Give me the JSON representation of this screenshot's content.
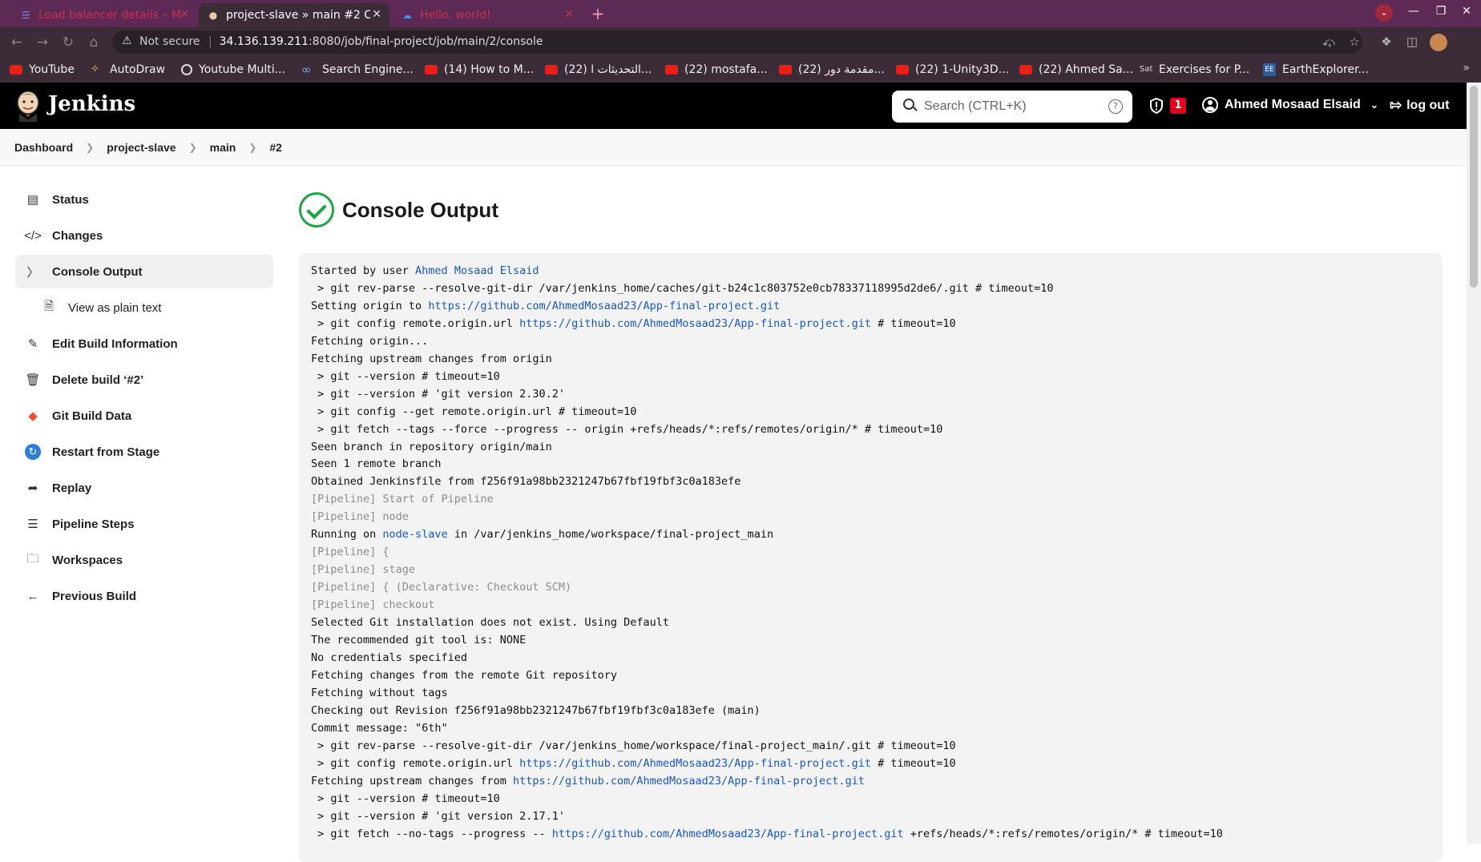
{
  "browser": {
    "tabs": [
      {
        "title": "Load balancer details – M",
        "favicon": "lb-icon"
      },
      {
        "title": "project-slave » main #2 Co",
        "favicon": "jenkins-icon",
        "active": true
      },
      {
        "title": "Hello, world!",
        "favicon": "cloud-icon"
      }
    ],
    "not_secure": "Not secure",
    "url_host": "34.136.139.211",
    "url_path": ":8080/job/final-project/job/main/2/console",
    "bookmarks": [
      {
        "label": "YouTube",
        "icon": "youtube"
      },
      {
        "label": "AutoDraw",
        "icon": "autodraw"
      },
      {
        "label": "Youtube Multi...",
        "icon": "globe"
      },
      {
        "label": "Search Engine...",
        "icon": "infinity"
      },
      {
        "label": "(14) How to M...",
        "icon": "youtube"
      },
      {
        "label": "(22) التحديثات ا...",
        "icon": "youtube"
      },
      {
        "label": "(22) mostafa...",
        "icon": "youtube"
      },
      {
        "label": "(22) مقدمة دور...",
        "icon": "youtube"
      },
      {
        "label": "(22) 1-Unity3D...",
        "icon": "youtube"
      },
      {
        "label": "(22) Ahmed Sa...",
        "icon": "youtube"
      },
      {
        "label": "Exercises for P...",
        "icon": "sat"
      },
      {
        "label": "EarthExplorer...",
        "icon": "ee"
      }
    ]
  },
  "header": {
    "brand": "Jenkins",
    "search_placeholder": "Search (CTRL+K)",
    "help": "?",
    "alert_count": "1",
    "user": "Ahmed Mosaad Elsaid",
    "logout": "log out"
  },
  "breadcrumb": [
    "Dashboard",
    "project-slave",
    "main",
    "#2"
  ],
  "sidebar": [
    {
      "label": "Status",
      "icon": "status-icon"
    },
    {
      "label": "Changes",
      "icon": "code-icon"
    },
    {
      "label": "Console Output",
      "icon": "terminal-icon",
      "active": true
    },
    {
      "label": "View as plain text",
      "icon": "document-icon",
      "sub": true
    },
    {
      "label": "Edit Build Information",
      "icon": "edit-icon"
    },
    {
      "label": "Delete build ‘#2’",
      "icon": "trash-icon"
    },
    {
      "label": "Git Build Data",
      "icon": "git-icon"
    },
    {
      "label": "Restart from Stage",
      "icon": "restart-icon"
    },
    {
      "label": "Replay",
      "icon": "replay-icon"
    },
    {
      "label": "Pipeline Steps",
      "icon": "steps-icon"
    },
    {
      "label": "Workspaces",
      "icon": "folder-icon"
    },
    {
      "label": "Previous Build",
      "icon": "arrow-left-icon"
    }
  ],
  "main": {
    "title": "Console Output",
    "lines": [
      {
        "parts": [
          {
            "t": "Started by user "
          },
          {
            "t": "Ahmed Mosaad Elsaid",
            "link": true
          }
        ]
      },
      {
        "parts": [
          {
            "t": " > git rev-parse --resolve-git-dir /var/jenkins_home/caches/git-b24c1c803752e0cb78337118995d2de6/.git # timeout=10"
          }
        ]
      },
      {
        "parts": [
          {
            "t": "Setting origin to "
          },
          {
            "t": "https://github.com/AhmedMosaad23/App-final-project.git",
            "link": true
          }
        ]
      },
      {
        "parts": [
          {
            "t": " > git config remote.origin.url "
          },
          {
            "t": "https://github.com/AhmedMosaad23/App-final-project.git",
            "link": true
          },
          {
            "t": " # timeout=10"
          }
        ]
      },
      {
        "parts": [
          {
            "t": "Fetching origin..."
          }
        ]
      },
      {
        "parts": [
          {
            "t": "Fetching upstream changes from origin"
          }
        ]
      },
      {
        "parts": [
          {
            "t": " > git --version # timeout=10"
          }
        ]
      },
      {
        "parts": [
          {
            "t": " > git --version # 'git version 2.30.2'"
          }
        ]
      },
      {
        "parts": [
          {
            "t": " > git config --get remote.origin.url # timeout=10"
          }
        ]
      },
      {
        "parts": [
          {
            "t": " > git fetch --tags --force --progress -- origin +refs/heads/*:refs/remotes/origin/* # timeout=10"
          }
        ]
      },
      {
        "parts": [
          {
            "t": "Seen branch in repository origin/main"
          }
        ]
      },
      {
        "parts": [
          {
            "t": "Seen 1 remote branch"
          }
        ]
      },
      {
        "parts": [
          {
            "t": "Obtained Jenkinsfile from f256f91a98bb2321247b67fbf19fbf3c0a183efe"
          }
        ]
      },
      {
        "pipe": true,
        "parts": [
          {
            "t": "[Pipeline] Start of Pipeline"
          }
        ]
      },
      {
        "pipe": true,
        "parts": [
          {
            "t": "[Pipeline] node"
          }
        ]
      },
      {
        "parts": [
          {
            "t": "Running on "
          },
          {
            "t": "node-slave",
            "link": true
          },
          {
            "t": " in /var/jenkins_home/workspace/final-project_main"
          }
        ]
      },
      {
        "pipe": true,
        "parts": [
          {
            "t": "[Pipeline] {"
          }
        ]
      },
      {
        "pipe": true,
        "parts": [
          {
            "t": "[Pipeline] stage"
          }
        ]
      },
      {
        "pipe": true,
        "parts": [
          {
            "t": "[Pipeline] { (Declarative: Checkout SCM)"
          }
        ]
      },
      {
        "pipe": true,
        "parts": [
          {
            "t": "[Pipeline] checkout"
          }
        ]
      },
      {
        "parts": [
          {
            "t": "Selected Git installation does not exist. Using Default"
          }
        ]
      },
      {
        "parts": [
          {
            "t": "The recommended git tool is: NONE"
          }
        ]
      },
      {
        "parts": [
          {
            "t": "No credentials specified"
          }
        ]
      },
      {
        "parts": [
          {
            "t": "Fetching changes from the remote Git repository"
          }
        ]
      },
      {
        "parts": [
          {
            "t": "Fetching without tags"
          }
        ]
      },
      {
        "parts": [
          {
            "t": "Checking out Revision f256f91a98bb2321247b67fbf19fbf3c0a183efe (main)"
          }
        ]
      },
      {
        "parts": [
          {
            "t": "Commit message: \"6th\""
          }
        ]
      },
      {
        "parts": [
          {
            "t": " > git rev-parse --resolve-git-dir /var/jenkins_home/workspace/final-project_main/.git # timeout=10"
          }
        ]
      },
      {
        "parts": [
          {
            "t": " > git config remote.origin.url "
          },
          {
            "t": "https://github.com/AhmedMosaad23/App-final-project.git",
            "link": true
          },
          {
            "t": " # timeout=10"
          }
        ]
      },
      {
        "parts": [
          {
            "t": "Fetching upstream changes from "
          },
          {
            "t": "https://github.com/AhmedMosaad23/App-final-project.git",
            "link": true
          }
        ]
      },
      {
        "parts": [
          {
            "t": " > git --version # timeout=10"
          }
        ]
      },
      {
        "parts": [
          {
            "t": " > git --version # 'git version 2.17.1'"
          }
        ]
      },
      {
        "parts": [
          {
            "t": " > git fetch --no-tags --progress -- "
          },
          {
            "t": "https://github.com/AhmedMosaad23/App-final-project.git",
            "link": true
          },
          {
            "t": " +refs/heads/*:refs/remotes/origin/* # timeout=10"
          }
        ]
      }
    ]
  },
  "colors": {
    "tabbar": "#5c2a55",
    "toolbar": "#3c2c38",
    "jenkins_header": "#000000",
    "success": "#1ea446",
    "link": "#1857c4",
    "badge": "#e6001f"
  }
}
